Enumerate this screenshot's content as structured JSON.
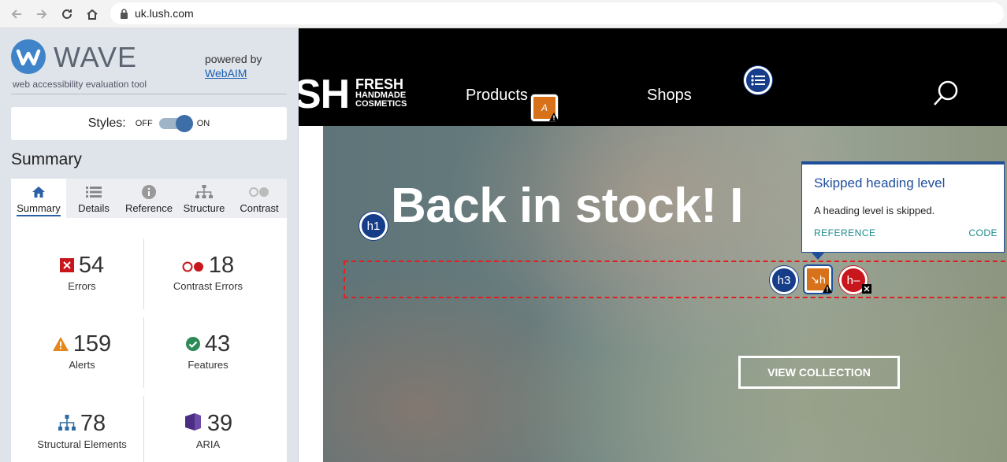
{
  "browser": {
    "url": "uk.lush.com",
    "icons": [
      "back-arrow",
      "forward-arrow",
      "reload",
      "home",
      "lock"
    ]
  },
  "wave": {
    "title": "WAVE",
    "tagline": "web accessibility evaluation tool",
    "powered_by": "powered by",
    "webaim_link": "WebAIM",
    "styles_label": "Styles:",
    "toggle_off": "OFF",
    "toggle_on": "ON",
    "summary_heading": "Summary",
    "tabs": [
      {
        "label": "Summary",
        "icon": "home-icon"
      },
      {
        "label": "Details",
        "icon": "list-icon"
      },
      {
        "label": "Reference",
        "icon": "info-icon"
      },
      {
        "label": "Structure",
        "icon": "structure-icon"
      },
      {
        "label": "Contrast",
        "icon": "contrast-icon"
      }
    ],
    "stats": [
      {
        "value": "54",
        "label": "Errors",
        "color": "#c8161d"
      },
      {
        "value": "18",
        "label": "Contrast Errors",
        "color": "#c8161d"
      },
      {
        "value": "159",
        "label": "Alerts",
        "color": "#e5871b"
      },
      {
        "value": "43",
        "label": "Features",
        "color": "#2e8b57"
      },
      {
        "value": "78",
        "label": "Structural Elements",
        "color": "#2d6ca2"
      },
      {
        "value": "39",
        "label": "ARIA",
        "color": "#4b2e83"
      }
    ]
  },
  "site": {
    "logo_sh": "SH",
    "logo_fresh": "FRESH",
    "logo_handmade": "HANDMADE",
    "logo_cosmetics": "COSMETICS",
    "nav": [
      "Products",
      "Shops"
    ],
    "hero_title": "Back in stock! I",
    "view_button": "VIEW COLLECTION",
    "badges": {
      "h1": "h1",
      "h3": "h3",
      "skipped": "h",
      "empty": "h–",
      "alt": "A"
    }
  },
  "tooltip": {
    "title": "Skipped heading level",
    "body": "A heading level is skipped.",
    "reference": "REFERENCE",
    "code": "CODE"
  }
}
